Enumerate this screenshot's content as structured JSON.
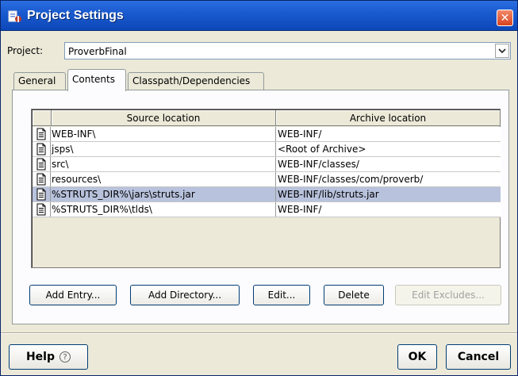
{
  "window": {
    "title": "Project Settings",
    "icon": "project-settings-icon",
    "close_glyph": "✕"
  },
  "project": {
    "label": "Project:",
    "value": "ProverbFinal"
  },
  "tabs": [
    {
      "label": "General",
      "active": false
    },
    {
      "label": "Contents",
      "active": true
    },
    {
      "label": "Classpath/Dependencies",
      "active": false
    }
  ],
  "table": {
    "columns": [
      "Source location",
      "Archive location"
    ],
    "rows": [
      {
        "source": "WEB-INF\\",
        "archive": "WEB-INF/",
        "selected": false
      },
      {
        "source": "jsps\\",
        "archive": "<Root of Archive>",
        "selected": false
      },
      {
        "source": "src\\",
        "archive": "WEB-INF/classes/",
        "selected": false
      },
      {
        "source": "resources\\",
        "archive": "WEB-INF/classes/com/proverb/",
        "selected": false
      },
      {
        "source": "%STRUTS_DIR%\\jars\\struts.jar",
        "archive": "WEB-INF/lib/struts.jar",
        "selected": true
      },
      {
        "source": "%STRUTS_DIR%\\tlds\\",
        "archive": "WEB-INF/",
        "selected": false
      }
    ]
  },
  "actions": {
    "add_entry": "Add Entry...",
    "add_directory": "Add Directory...",
    "edit": "Edit...",
    "delete": "Delete",
    "edit_excludes": "Edit Excludes..."
  },
  "footer": {
    "help": "Help",
    "help_glyph": "?",
    "ok": "OK",
    "cancel": "Cancel"
  },
  "colors": {
    "titlebar": "#1a5bd0",
    "selected_row": "#b8c2dc",
    "close_button": "#d6431f"
  }
}
